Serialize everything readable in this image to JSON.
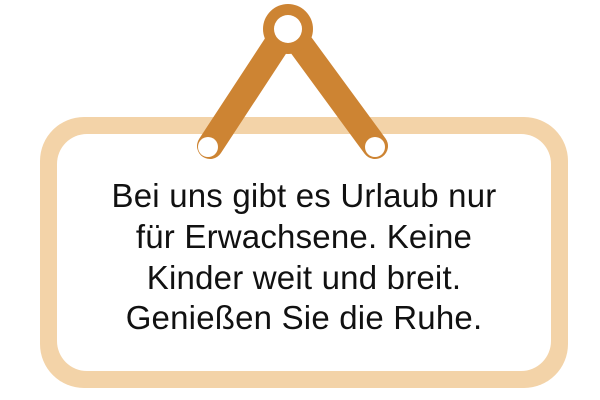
{
  "sign": {
    "lines": [
      "Bei uns gibt es Urlaub nur",
      "für Erwachsene. Keine",
      "Kinder weit und breit.",
      "Genießen Sie die Ruhe."
    ],
    "text_color": "#111111",
    "frame_color": "#F3D3A8",
    "panel_color": "#FFFFFF",
    "hanger_color": "#CD8433"
  }
}
